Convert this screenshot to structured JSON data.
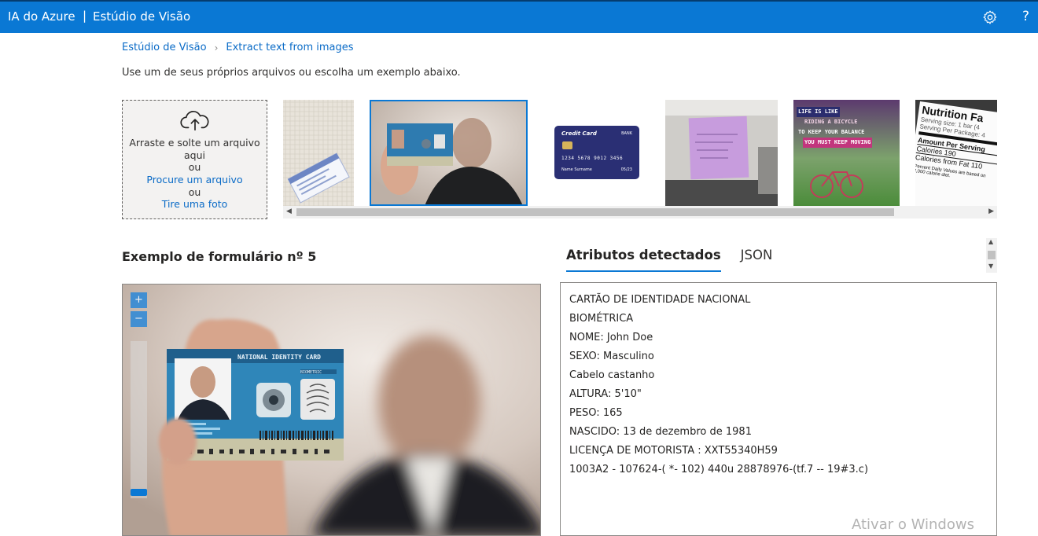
{
  "header": {
    "brand": "IA do Azure",
    "separator": "|",
    "product": "Estúdio de Visão",
    "help_label": "?"
  },
  "breadcrumb": {
    "items": [
      "Estúdio de Visão",
      "Extract text from images"
    ],
    "chevron": "›"
  },
  "intro_text": "Use um de seus próprios arquivos ou escolha um exemplo abaixo.",
  "upload": {
    "line1": "Arraste e solte um arquivo",
    "line2": "aqui",
    "or1": "ou",
    "browse_link": "Procure um arquivo",
    "or2": "ou",
    "photo_link": "Tire uma foto"
  },
  "thumbnails": {
    "credit_card_brand": "Credit Card",
    "credit_card_bank": "BANK",
    "credit_card_number": "1234 5678 9012 3456",
    "credit_card_name": "Name Surname",
    "credit_card_expiry": "05/23",
    "poster_lines": [
      "LIFE IS LIKE",
      "RIDING A BICYCLE",
      "TO KEEP YOUR BALANCE",
      "YOU MUST KEEP MOVING"
    ],
    "nutrition_title": "Nutrition Fa",
    "nutrition_lines": [
      "Serving size: 1 bar (4",
      "Serving Per Package: 4",
      "Amount Per Serving",
      "Calories 190",
      "Calories from Fat 110",
      "Percent Daily Values are based on",
      "2,000 calorie diet."
    ]
  },
  "sample_title": "Exemplo de formulário nº 5",
  "tabs": [
    {
      "label": "Atributos detectados",
      "active": true
    },
    {
      "label": "JSON",
      "active": false
    }
  ],
  "viewer": {
    "zoom_in": "+",
    "zoom_out": "−",
    "card_title": "NATIONAL IDENTITY CARD",
    "card_subtitle": "BIOMETRIC"
  },
  "results": {
    "lines": [
      "CARTÃO  DE IDENTIDADE  NACIONAL",
      "BIOMÉTRICA",
      "NOME: John  Doe",
      "SEXO: Masculino",
      "Cabelo  castanho",
      "ALTURA:  5'10\"",
      "PESO:  165",
      "NASCIDO:  13  de dezembro  de 1981",
      "LICENÇA DE MOTORISTA :  XXT55340H59",
      "1003A2  -  107624-(  *-  102)  440u  28878976-(tf.7  --  19#3.c)"
    ]
  },
  "watermark": "Ativar o Windows",
  "colors": {
    "header_bg": "#0a78d4",
    "link": "#0a6bc7",
    "accent": "#0a78d4"
  },
  "icons": {
    "settings": "gear-icon",
    "upload": "cloud-upload-icon"
  }
}
